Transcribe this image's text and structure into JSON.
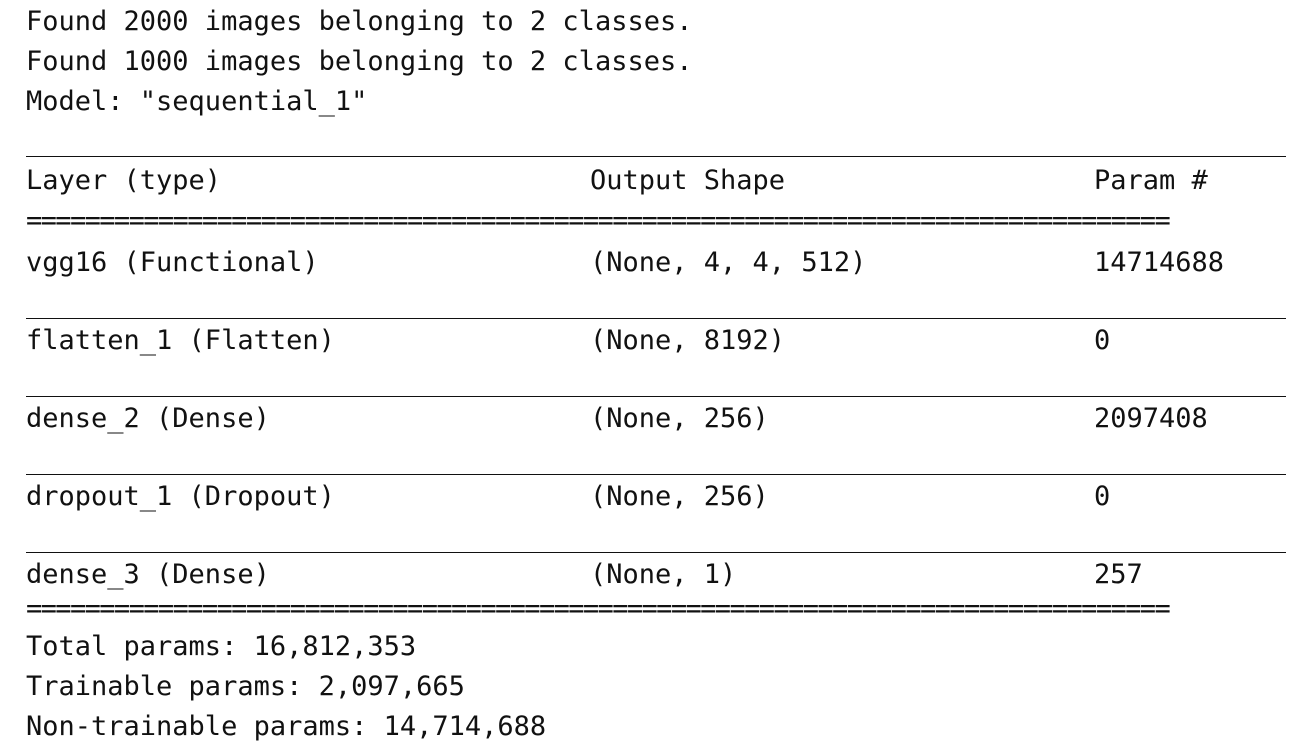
{
  "log": {
    "lines": [
      "Found 2000 images belonging to 2 classes.",
      "Found 1000 images belonging to 2 classes.",
      "Model: \"sequential_1\""
    ]
  },
  "table": {
    "headers": {
      "layer": "Layer (type)",
      "shape": "Output Shape",
      "param": "Param #"
    },
    "double_rule": "==============================================================================",
    "rows": [
      {
        "layer": "vgg16 (Functional)",
        "shape": "(None, 4, 4, 512)",
        "param": "14714688"
      },
      {
        "layer": "flatten_1 (Flatten)",
        "shape": "(None, 8192)",
        "param": "0"
      },
      {
        "layer": "dense_2 (Dense)",
        "shape": "(None, 256)",
        "param": "2097408"
      },
      {
        "layer": "dropout_1 (Dropout)",
        "shape": "(None, 256)",
        "param": "0"
      },
      {
        "layer": "dense_3 (Dense)",
        "shape": "(None, 1)",
        "param": "257"
      }
    ]
  },
  "summary": {
    "total": "Total params: 16,812,353",
    "trainable": "Trainable params: 2,097,665",
    "non_trainable": "Non-trainable params: 14,714,688"
  }
}
